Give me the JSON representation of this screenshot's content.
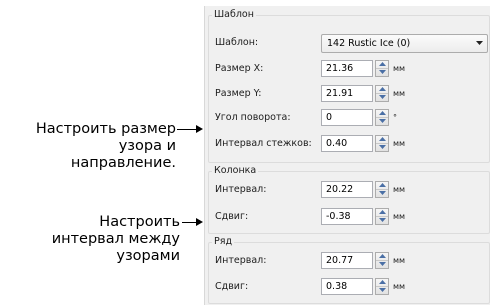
{
  "annotations": {
    "pattern_size": {
      "lines": [
        "Настроить размер",
        "узора и",
        "направление."
      ]
    },
    "spacing": {
      "lines": [
        "Настроить",
        "интервал между",
        "узорами"
      ]
    }
  },
  "groups": {
    "template": {
      "title": "Шаблон"
    },
    "column": {
      "title": "Колонка"
    },
    "row": {
      "title": "Ряд"
    }
  },
  "fields": {
    "template_select": {
      "label": "Шаблон:",
      "value": "142 Rustic Ice (0)"
    },
    "size_x": {
      "label": "Размер X:",
      "value": "21.36",
      "unit": "мм"
    },
    "size_y": {
      "label": "Размер Y:",
      "value": "21.91",
      "unit": "мм"
    },
    "rotation": {
      "label": "Угол поворота:",
      "value": "0",
      "unit": "°"
    },
    "stitch_spacing": {
      "label": "Интервал стежков:",
      "value": "0.40",
      "unit": "мм"
    },
    "column_spacing": {
      "label": "Интервал:",
      "value": "20.22",
      "unit": "мм"
    },
    "column_offset": {
      "label": "Сдвиг:",
      "value": "-0.38",
      "unit": "мм"
    },
    "row_spacing": {
      "label": "Интервал:",
      "value": "20.77",
      "unit": "мм"
    },
    "row_offset": {
      "label": "Сдвиг:",
      "value": "0.38",
      "unit": "мм"
    }
  },
  "icons": {
    "spin": "spin-up-down-icon",
    "combo": "chevron-down-icon"
  }
}
